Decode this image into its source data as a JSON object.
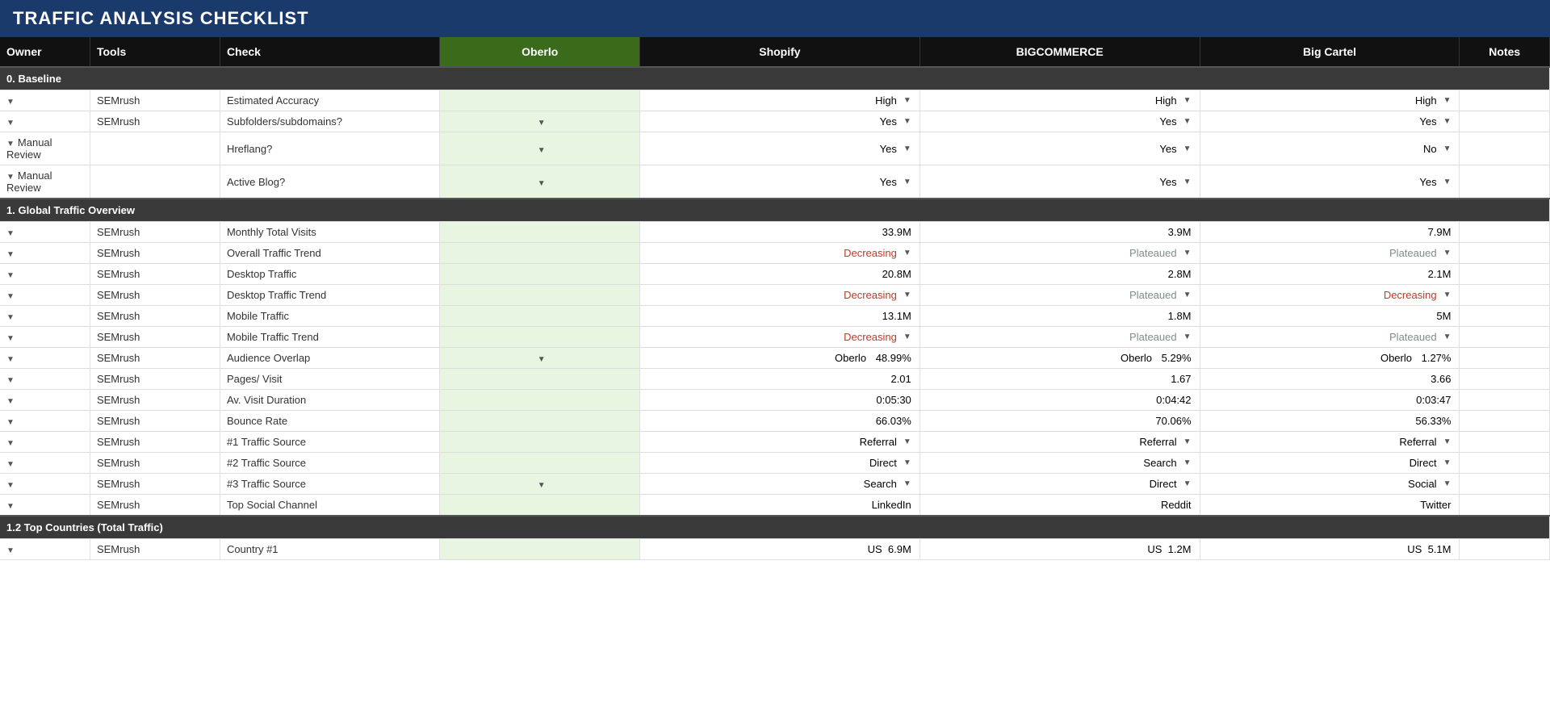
{
  "title": "TRAFFIC ANALYSIS CHECKLIST",
  "columns": {
    "owner": "Owner",
    "tools": "Tools",
    "check": "Check",
    "oberlo": "Oberlo",
    "shopify": "Shopify",
    "bigcommerce": "BIGCOMMERCE",
    "bigcartel": "Big Cartel",
    "notes": "Notes"
  },
  "sections": [
    {
      "label": "0. Baseline",
      "rows": [
        {
          "owner": "",
          "tools": "SEMrush",
          "check": "Estimated Accuracy",
          "oberlo": "",
          "shopify": "High",
          "bigcommerce": "High",
          "bigcartel": "High",
          "shopify_arrow": true,
          "bc_arrow": true,
          "bca_arrow": true,
          "oberlo_arrow": false
        },
        {
          "owner": "",
          "tools": "SEMrush",
          "check": "Subfolders/subdomains?",
          "oberlo": "",
          "shopify": "Yes",
          "bigcommerce": "Yes",
          "bigcartel": "Yes",
          "shopify_arrow": true,
          "bc_arrow": true,
          "bca_arrow": true,
          "oberlo_arrow": true
        },
        {
          "owner": "Manual Review",
          "tools": "",
          "check": "Hreflang?",
          "oberlo": "",
          "shopify": "Yes",
          "bigcommerce": "Yes",
          "bigcartel": "No",
          "shopify_arrow": true,
          "bc_arrow": true,
          "bca_arrow": true,
          "oberlo_arrow": true
        },
        {
          "owner": "Manual Review",
          "tools": "",
          "check": "Active Blog?",
          "oberlo": "",
          "shopify": "Yes",
          "bigcommerce": "Yes",
          "bigcartel": "Yes",
          "shopify_arrow": true,
          "bc_arrow": true,
          "bca_arrow": true,
          "oberlo_arrow": true
        }
      ]
    },
    {
      "label": "1. Global Traffic Overview",
      "rows": [
        {
          "owner": "",
          "tools": "SEMrush",
          "check": "Monthly Total Visits",
          "oberlo": "",
          "shopify": "33.9M",
          "bigcommerce": "3.9M",
          "bigcartel": "7.9M",
          "shopify_arrow": false,
          "bc_arrow": false,
          "bca_arrow": false,
          "oberlo_arrow": false
        },
        {
          "owner": "",
          "tools": "SEMrush",
          "check": "Overall Traffic Trend",
          "oberlo": "",
          "shopify": "Decreasing",
          "bigcommerce": "Plateaued",
          "bigcartel": "Plateaued",
          "shopify_arrow": true,
          "bc_arrow": true,
          "bca_arrow": true,
          "oberlo_arrow": false,
          "shopify_class": "text-decreasing",
          "bc_class": "text-plateaued",
          "bca_class": "text-plateaued"
        },
        {
          "owner": "",
          "tools": "SEMrush",
          "check": "Desktop Traffic",
          "oberlo": "",
          "shopify": "20.8M",
          "bigcommerce": "2.8M",
          "bigcartel": "2.1M",
          "shopify_arrow": false,
          "bc_arrow": false,
          "bca_arrow": false,
          "oberlo_arrow": false
        },
        {
          "owner": "",
          "tools": "SEMrush",
          "check": "Desktop Traffic Trend",
          "oberlo": "",
          "shopify": "Decreasing",
          "bigcommerce": "Plateaued",
          "bigcartel": "Decreasing",
          "shopify_arrow": true,
          "bc_arrow": true,
          "bca_arrow": true,
          "oberlo_arrow": false,
          "shopify_class": "text-decreasing",
          "bc_class": "text-plateaued",
          "bca_class": "text-decreasing"
        },
        {
          "owner": "",
          "tools": "SEMrush",
          "check": "Mobile Traffic",
          "oberlo": "",
          "shopify": "13.1M",
          "bigcommerce": "1.8M",
          "bigcartel": "5M",
          "shopify_arrow": false,
          "bc_arrow": false,
          "bca_arrow": false,
          "oberlo_arrow": false
        },
        {
          "owner": "",
          "tools": "SEMrush",
          "check": "Mobile Traffic Trend",
          "oberlo": "",
          "shopify": "Decreasing",
          "bigcommerce": "Plateaued",
          "bigcartel": "Plateaued",
          "shopify_arrow": true,
          "bc_arrow": true,
          "bca_arrow": true,
          "oberlo_arrow": false,
          "shopify_class": "text-decreasing",
          "bc_class": "text-plateaued",
          "bca_class": "text-plateaued"
        },
        {
          "owner": "",
          "tools": "SEMrush",
          "check": "Audience Overlap",
          "oberlo": "",
          "shopify_label": "Oberlo",
          "shopify_val": "48.99%",
          "bigcommerce_label": "Oberlo",
          "bigcommerce_val": "5.29%",
          "bigcartel_label": "Oberlo",
          "bigcartel_val": "1.27%",
          "type": "overlap",
          "oberlo_arrow": true
        },
        {
          "owner": "",
          "tools": "SEMrush",
          "check": "Pages/ Visit",
          "oberlo": "",
          "shopify": "2.01",
          "bigcommerce": "1.67",
          "bigcartel": "3.66",
          "shopify_arrow": false,
          "bc_arrow": false,
          "bca_arrow": false,
          "oberlo_arrow": false
        },
        {
          "owner": "",
          "tools": "SEMrush",
          "check": "Av. Visit Duration",
          "oberlo": "",
          "shopify": "0:05:30",
          "bigcommerce": "0:04:42",
          "bigcartel": "0:03:47",
          "shopify_arrow": false,
          "bc_arrow": false,
          "bca_arrow": false,
          "oberlo_arrow": false
        },
        {
          "owner": "",
          "tools": "SEMrush",
          "check": "Bounce Rate",
          "oberlo": "",
          "shopify": "66.03%",
          "bigcommerce": "70.06%",
          "bigcartel": "56.33%",
          "shopify_arrow": false,
          "bc_arrow": false,
          "bca_arrow": false,
          "oberlo_arrow": false
        },
        {
          "owner": "",
          "tools": "SEMrush",
          "check": "#1 Traffic Source",
          "oberlo": "",
          "shopify": "Referral",
          "bigcommerce": "Referral",
          "bigcartel": "Referral",
          "shopify_arrow": true,
          "bc_arrow": true,
          "bca_arrow": true,
          "oberlo_arrow": false
        },
        {
          "owner": "",
          "tools": "SEMrush",
          "check": "#2 Traffic Source",
          "oberlo": "",
          "shopify": "Direct",
          "bigcommerce": "Search",
          "bigcartel": "Direct",
          "shopify_arrow": true,
          "bc_arrow": true,
          "bca_arrow": true,
          "oberlo_arrow": false
        },
        {
          "owner": "",
          "tools": "SEMrush",
          "check": "#3 Traffic Source",
          "oberlo": "",
          "shopify": "Search",
          "bigcommerce": "Direct",
          "bigcartel": "Social",
          "shopify_arrow": true,
          "bc_arrow": true,
          "bca_arrow": true,
          "oberlo_arrow": true
        },
        {
          "owner": "",
          "tools": "SEMrush",
          "check": "Top Social Channel",
          "oberlo": "",
          "shopify": "LinkedIn",
          "bigcommerce": "Reddit",
          "bigcartel": "Twitter",
          "shopify_arrow": false,
          "bc_arrow": false,
          "bca_arrow": false,
          "oberlo_arrow": false
        }
      ]
    },
    {
      "label": "1.2 Top Countries (Total Traffic)",
      "rows": [
        {
          "owner": "",
          "tools": "SEMrush",
          "check": "Country #1",
          "oberlo": "",
          "shopify_label": "US",
          "shopify_val": "6.9M",
          "bigcommerce_label": "US",
          "bigcommerce_val": "1.2M",
          "bigcartel_label": "US",
          "bigcartel_val": "5.1M",
          "type": "country",
          "shopify_arrow": false,
          "bc_arrow": false,
          "bca_arrow": false,
          "oberlo_arrow": false
        }
      ]
    }
  ]
}
